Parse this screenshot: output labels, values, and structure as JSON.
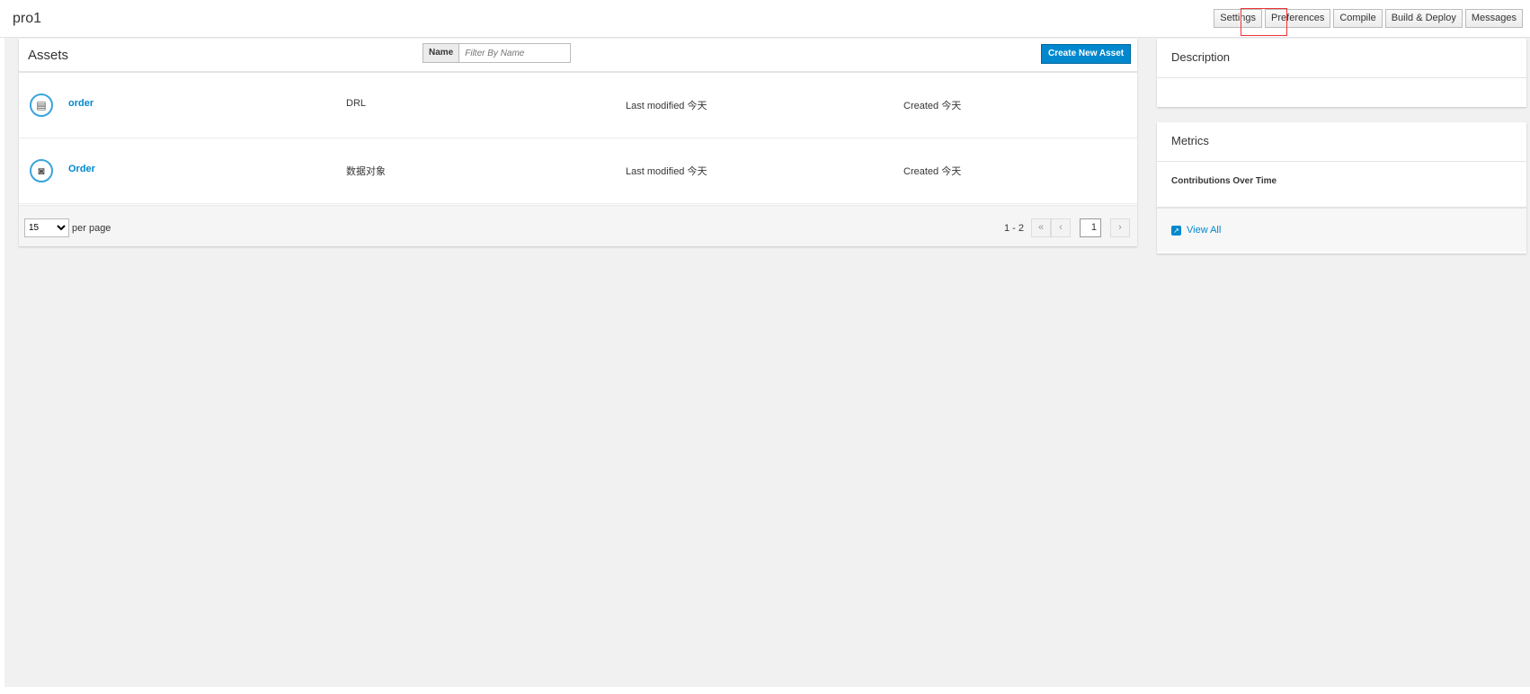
{
  "header": {
    "title": "pro1",
    "buttons": [
      "Settings",
      "Preferences",
      "Compile",
      "Build & Deploy",
      "Messages"
    ]
  },
  "assets": {
    "title": "Assets",
    "filter_label": "Name",
    "filter_placeholder": "Filter By Name",
    "create_label": "Create New Asset",
    "rows": [
      {
        "name": "order",
        "type": "DRL",
        "modified": "Last modified 今天",
        "created": "Created 今天"
      },
      {
        "name": "Order",
        "type": "数据对象",
        "modified": "Last modified 今天",
        "created": "Created 今天"
      }
    ],
    "per_page": "15",
    "per_page_label": "per page",
    "range": "1 - 2",
    "page": "1"
  },
  "side": {
    "description_title": "Description",
    "metrics_title": "Metrics",
    "contributions": "Contributions Over Time",
    "view_all": "View All"
  }
}
